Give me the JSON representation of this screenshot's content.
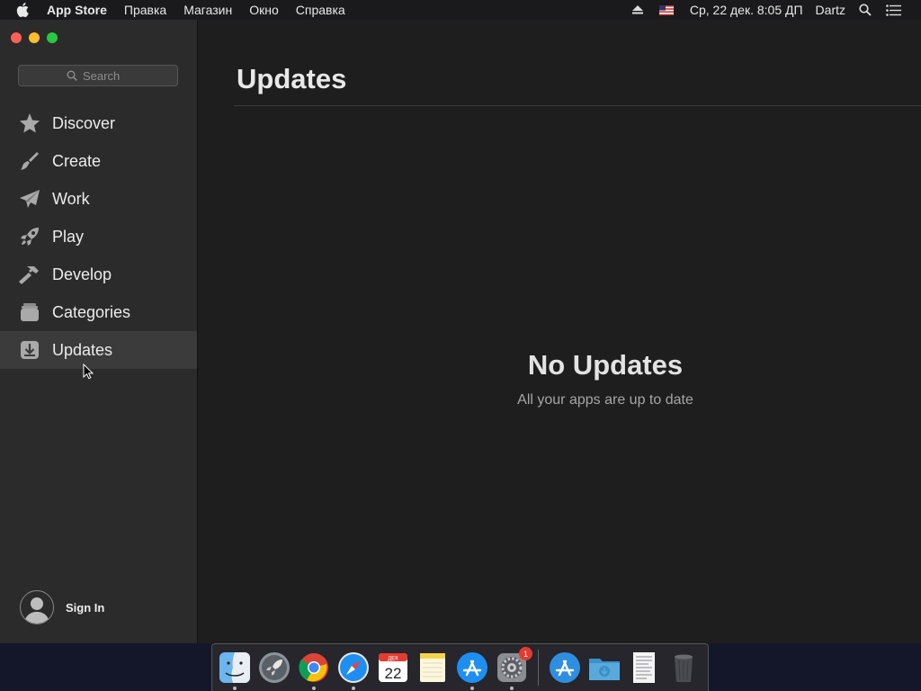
{
  "menubar": {
    "app_name": "App Store",
    "items": [
      "Правка",
      "Магазин",
      "Окно",
      "Справка"
    ],
    "clock": "Ср, 22 дек.  8:05 ДП",
    "user": "Dartz"
  },
  "sidebar": {
    "search_placeholder": "Search",
    "items": [
      {
        "label": "Discover",
        "icon": "star-icon"
      },
      {
        "label": "Create",
        "icon": "brush-icon"
      },
      {
        "label": "Work",
        "icon": "paper-plane-icon"
      },
      {
        "label": "Play",
        "icon": "rocket-icon"
      },
      {
        "label": "Develop",
        "icon": "hammer-icon"
      },
      {
        "label": "Categories",
        "icon": "categories-icon"
      },
      {
        "label": "Updates",
        "icon": "download-icon",
        "active": true
      }
    ],
    "sign_in": "Sign In"
  },
  "main": {
    "title": "Updates",
    "empty_title": "No Updates",
    "empty_subtitle": "All your apps are up to date"
  },
  "dock": {
    "calendar_month": "ДЕК",
    "calendar_day": "22",
    "settings_badge": "1"
  },
  "colors": {
    "accent_blue": "#1e8ff0",
    "close": "#ff5f57",
    "minimize": "#febc2e",
    "maximize": "#28c840"
  }
}
